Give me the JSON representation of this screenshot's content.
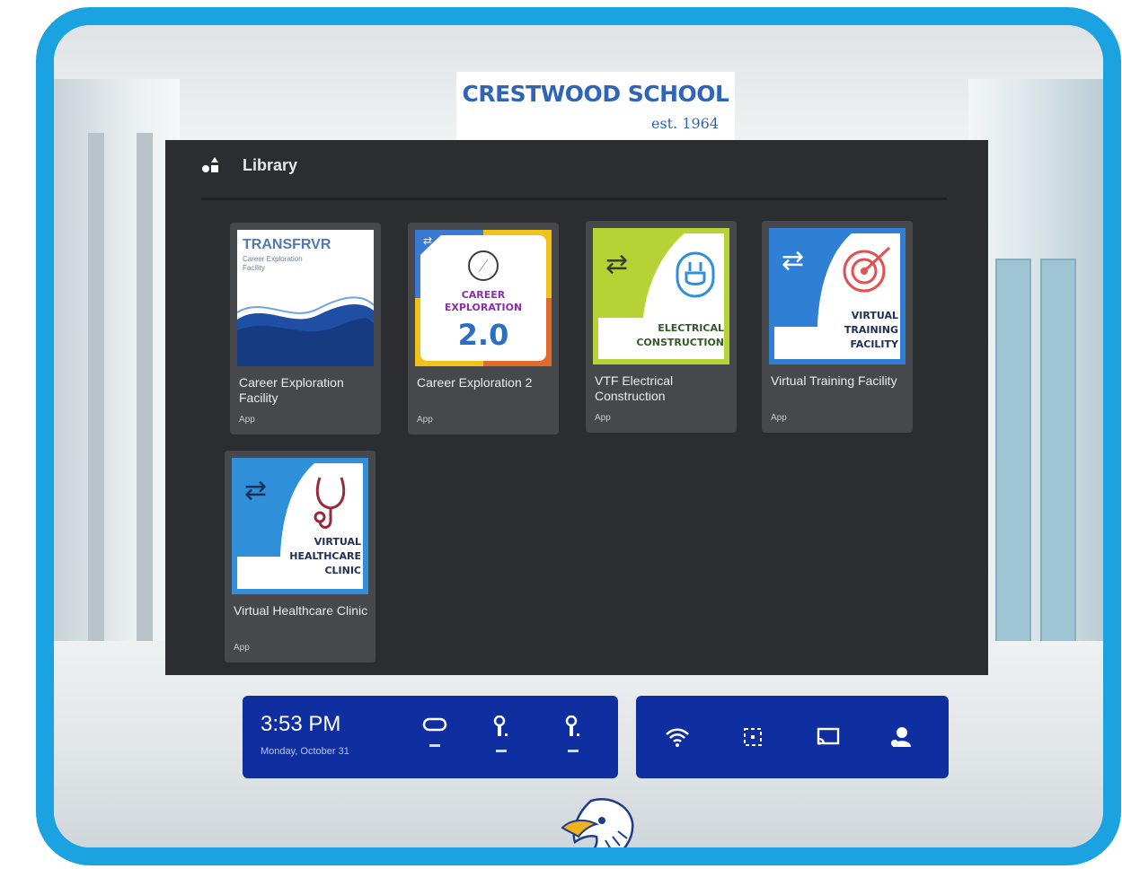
{
  "sign": {
    "title": "CRESTWOOD SCHOOL",
    "subtitle": "est. 1964"
  },
  "library": {
    "title": "Library",
    "apps": [
      {
        "name": "Career Exploration Facility",
        "type": "App",
        "art": {
          "heading": "TRANSFRVR",
          "sub": "Career Exploration Facility"
        }
      },
      {
        "name": "Career Exploration 2",
        "type": "App",
        "art": {
          "line1": "CAREER",
          "line2": "EXPLORATION",
          "version": "2.0"
        }
      },
      {
        "name": "VTF Electrical Construction",
        "type": "App",
        "art": {
          "line1": "ELECTRICAL",
          "line2": "CONSTRUCTION"
        }
      },
      {
        "name": "Virtual Training Facility",
        "type": "App",
        "art": {
          "line1": "VIRTUAL",
          "line2": "TRAINING",
          "line3": "FACILITY"
        }
      },
      {
        "name": "Virtual Healthcare Clinic",
        "type": "App",
        "art": {
          "line1": "VIRTUAL",
          "line2": "HEALTHCARE",
          "line3": "CLINIC"
        }
      }
    ]
  },
  "taskbar": {
    "time": "3:53 PM",
    "date": "Monday, October 31",
    "status_icons": [
      "headset-icon",
      "left-controller-icon",
      "right-controller-icon"
    ],
    "quick_settings": [
      "wifi-icon",
      "guardian-icon",
      "cast-icon",
      "profile-icon"
    ]
  },
  "colors": {
    "frame": "#1aa3e0",
    "taskbar": "#0f2ea0",
    "panel": "#2b2d31",
    "card": "#46484c"
  }
}
